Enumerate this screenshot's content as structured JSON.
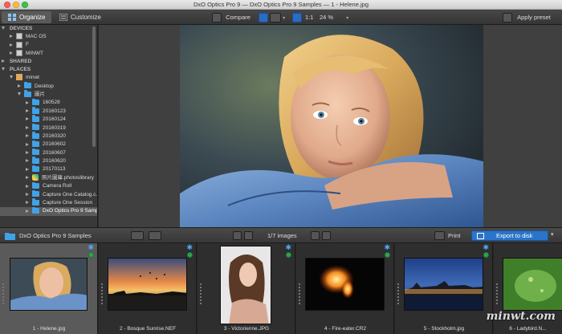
{
  "window": {
    "title": "DxO Optics Pro 9 — DxO Optics Pro 9 Samples — 1 - Helene.jpg"
  },
  "toolbar": {
    "tabs": [
      {
        "label": "Organize",
        "active": true
      },
      {
        "label": "Customize",
        "active": false
      }
    ],
    "compare_label": "Compare",
    "zoom_ratio": "1:1",
    "zoom_level": "24 %",
    "apply_preset_label": "Apply preset"
  },
  "sidebar": {
    "devices_header": "DEVICES",
    "devices": [
      "MAC OS",
      "F",
      "MINWT"
    ],
    "shared_header": "SHARED",
    "places_header": "PLACES",
    "places": [
      {
        "label": "minwt",
        "icon": "home-icon",
        "indent": 0,
        "expanded": true
      },
      {
        "label": "Desktop",
        "icon": "folder-icon",
        "indent": 1,
        "expanded": false
      },
      {
        "label": "圖片",
        "icon": "folder-icon",
        "indent": 1,
        "expanded": true
      },
      {
        "label": "160528",
        "icon": "folder-icon",
        "indent": 2,
        "expanded": false
      },
      {
        "label": "20160123",
        "icon": "folder-icon",
        "indent": 2,
        "expanded": false
      },
      {
        "label": "20160124",
        "icon": "folder-icon",
        "indent": 2,
        "expanded": false
      },
      {
        "label": "20160319",
        "icon": "folder-icon",
        "indent": 2,
        "expanded": false
      },
      {
        "label": "20160320",
        "icon": "folder-icon",
        "indent": 2,
        "expanded": false
      },
      {
        "label": "20160602",
        "icon": "folder-icon",
        "indent": 2,
        "expanded": false
      },
      {
        "label": "20160607",
        "icon": "folder-icon",
        "indent": 2,
        "expanded": false
      },
      {
        "label": "20160620",
        "icon": "folder-icon",
        "indent": 2,
        "expanded": false
      },
      {
        "label": "20170113",
        "icon": "folder-icon",
        "indent": 2,
        "expanded": false
      },
      {
        "label": "照片圖庫.photoslibrary",
        "icon": "library-icon",
        "indent": 2,
        "expanded": false
      },
      {
        "label": "Camera Roll",
        "icon": "folder-icon",
        "indent": 2,
        "expanded": false
      },
      {
        "label": "Capture One Catalog.c...",
        "icon": "folder-icon",
        "indent": 2,
        "expanded": false
      },
      {
        "label": "Capture One Session",
        "icon": "folder-icon",
        "indent": 2,
        "expanded": false
      },
      {
        "label": "DxO Optics Pro 9 Samp...",
        "icon": "folder-icon",
        "indent": 2,
        "expanded": false,
        "selected": true
      }
    ]
  },
  "filmstrip_bar": {
    "folder_name": "DxO Optics Pro 9 Samples",
    "image_count": "1/7 images",
    "print_label": "Print",
    "export_label": "Export to disk"
  },
  "filmstrip": {
    "thumbs": [
      {
        "label": "1 - Helene.jpg",
        "selected": true
      },
      {
        "label": "2 - Bosque Sunrise.NEF",
        "selected": false
      },
      {
        "label": "3 - Victorienne.JPG",
        "selected": false
      },
      {
        "label": "4 - Fire-eater.CR2",
        "selected": false
      },
      {
        "label": "5 - Stockholm.jpg",
        "selected": false
      },
      {
        "label": "6 - Ladybird.N...",
        "selected": false
      }
    ]
  },
  "watermark": "minwt.com",
  "colors": {
    "accent": "#2a74c9",
    "folder": "#41a2e8",
    "ok_badge": "#2ea44f",
    "star": "#4aa8f0"
  }
}
